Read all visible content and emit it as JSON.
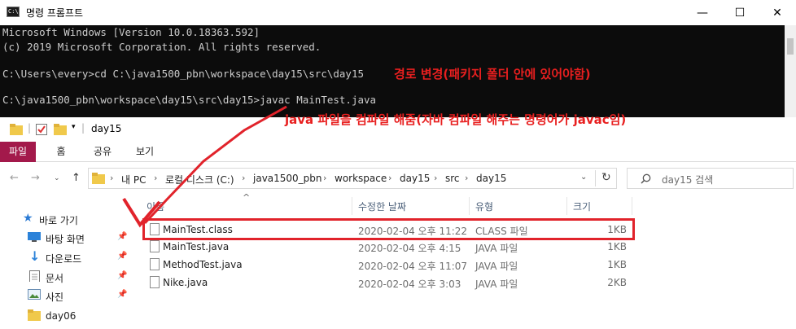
{
  "cmd": {
    "title": "명령 프롬프트",
    "icon_text": "C:\\.",
    "lines": [
      "Microsoft Windows [Version 10.0.18363.592]",
      "(c) 2019 Microsoft Corporation. All rights reserved.",
      "C:\\Users\\every>cd C:\\java1500_pbn\\workspace\\day15\\src\\day15",
      "C:\\java1500_pbn\\workspace\\day15\\src\\day15>javac MainTest.java"
    ],
    "window_buttons": {
      "minimize": "—",
      "maximize": "☐",
      "close": "✕"
    }
  },
  "annotations": {
    "path_change": "경로 변경(패키지 폴더 안에 있어야함)",
    "compile_note": "java 파일을 컴파일 해줌(자바 컴파일 해주는 명령어가 javac임)",
    "color": "#e81f1f"
  },
  "explorer": {
    "title": "day15",
    "ribbon_tabs": [
      "파일",
      "홈",
      "공유",
      "보기"
    ],
    "breadcrumbs": [
      "내 PC",
      "로컬 디스크 (C:)",
      "java1500_pbn",
      "workspace",
      "day15",
      "src",
      "day15"
    ],
    "search_placeholder": "day15 검색",
    "columns": {
      "name": "이름",
      "modified": "수정한 날짜",
      "type": "유형",
      "size": "크기"
    },
    "nav_items": [
      {
        "label": "바로 가기",
        "icon": "star-icon"
      },
      {
        "label": "바탕 화면",
        "icon": "desktop-icon"
      },
      {
        "label": "다운로드",
        "icon": "download-icon"
      },
      {
        "label": "문서",
        "icon": "document-icon"
      },
      {
        "label": "사진",
        "icon": "picture-icon"
      },
      {
        "label": "day06",
        "icon": "folder-icon"
      }
    ],
    "files": [
      {
        "name": "MainTest.class",
        "modified": "2020-02-04 오후 11:22",
        "type": "CLASS 파일",
        "size": "1KB"
      },
      {
        "name": "MainTest.java",
        "modified": "2020-02-04 오후 4:15",
        "type": "JAVA 파일",
        "size": "1KB"
      },
      {
        "name": "MethodTest.java",
        "modified": "2020-02-04 오후 11:07",
        "type": "JAVA 파일",
        "size": "1KB"
      },
      {
        "name": "Nike.java",
        "modified": "2020-02-04 오후 3:03",
        "type": "JAVA 파일",
        "size": "2KB"
      }
    ]
  }
}
